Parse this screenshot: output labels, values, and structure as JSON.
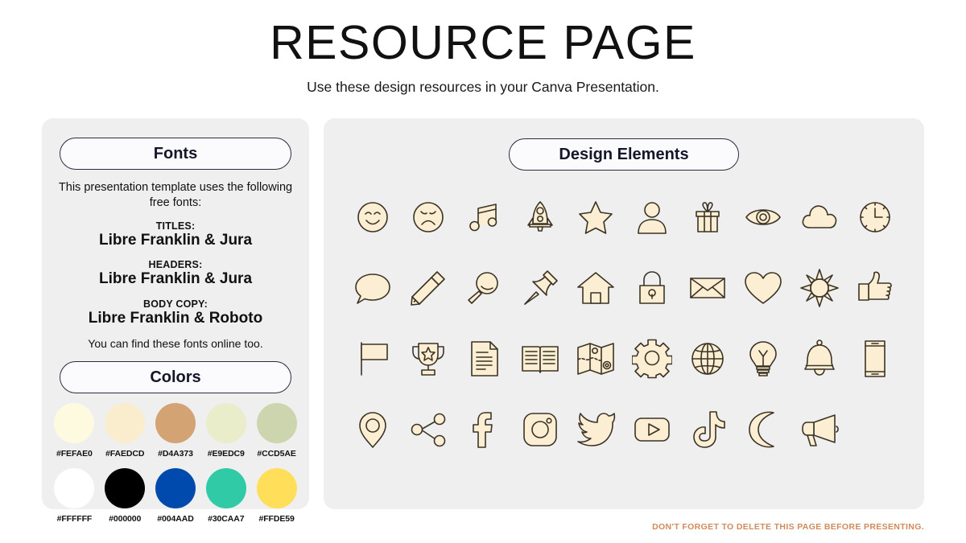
{
  "header": {
    "title": "RESOURCE PAGE",
    "subtitle": "Use these design resources in your Canva Presentation."
  },
  "fonts_panel": {
    "badge": "Fonts",
    "intro": "This presentation template uses the following free fonts:",
    "groups": [
      {
        "label": "TITLES:",
        "value": "Libre Franklin & Jura"
      },
      {
        "label": "HEADERS:",
        "value": "Libre Franklin & Jura"
      },
      {
        "label": "BODY COPY:",
        "value": "Libre Franklin & Roboto"
      }
    ],
    "footnote": "You can find these fonts online too."
  },
  "colors_panel": {
    "badge": "Colors",
    "rows": [
      [
        {
          "hex": "#FEFAE0",
          "label": "#FEFAE0"
        },
        {
          "hex": "#FAEDCD",
          "label": "#FAEDCD"
        },
        {
          "hex": "#D4A373",
          "label": "#D4A373"
        },
        {
          "hex": "#E9EDC9",
          "label": "#E9EDC9"
        },
        {
          "hex": "#CCD5AE",
          "label": "#CCD5AE"
        }
      ],
      [
        {
          "hex": "#FFFFFF",
          "label": "#FFFFFF"
        },
        {
          "hex": "#000000",
          "label": "#000000"
        },
        {
          "hex": "#004AAD",
          "label": "#004AAD"
        },
        {
          "hex": "#30CAA7",
          "label": "#30CAA7"
        },
        {
          "hex": "#FFDE59",
          "label": "#FFDE59"
        }
      ]
    ]
  },
  "design_panel": {
    "badge": "Design Elements",
    "icons": [
      "smiley-face-icon",
      "sad-face-icon",
      "music-note-icon",
      "rocket-icon",
      "star-icon",
      "person-icon",
      "gift-icon",
      "eye-icon",
      "cloud-icon",
      "clock-icon",
      "speech-bubble-icon",
      "pencil-icon",
      "magnifier-icon",
      "pushpin-icon",
      "house-icon",
      "lock-icon",
      "envelope-icon",
      "heart-icon",
      "sun-icon",
      "thumbs-up-icon",
      "flag-icon",
      "trophy-icon",
      "document-icon",
      "book-icon",
      "map-icon",
      "gear-icon",
      "globe-icon",
      "lightbulb-icon",
      "bell-icon",
      "phone-icon",
      "location-pin-icon",
      "share-icon",
      "facebook-icon",
      "instagram-icon",
      "twitter-icon",
      "youtube-icon",
      "tiktok-icon",
      "moon-icon",
      "megaphone-icon"
    ]
  },
  "footer": {
    "note": "DON'T FORGET TO DELETE THIS PAGE BEFORE PRESENTING.",
    "color": "#D08A5C"
  },
  "theme": {
    "panel_background": "#EFEFEF",
    "pill_border": "#2B2B3F",
    "icon_fill": "#FBEED2",
    "icon_stroke": "#3B3326"
  }
}
